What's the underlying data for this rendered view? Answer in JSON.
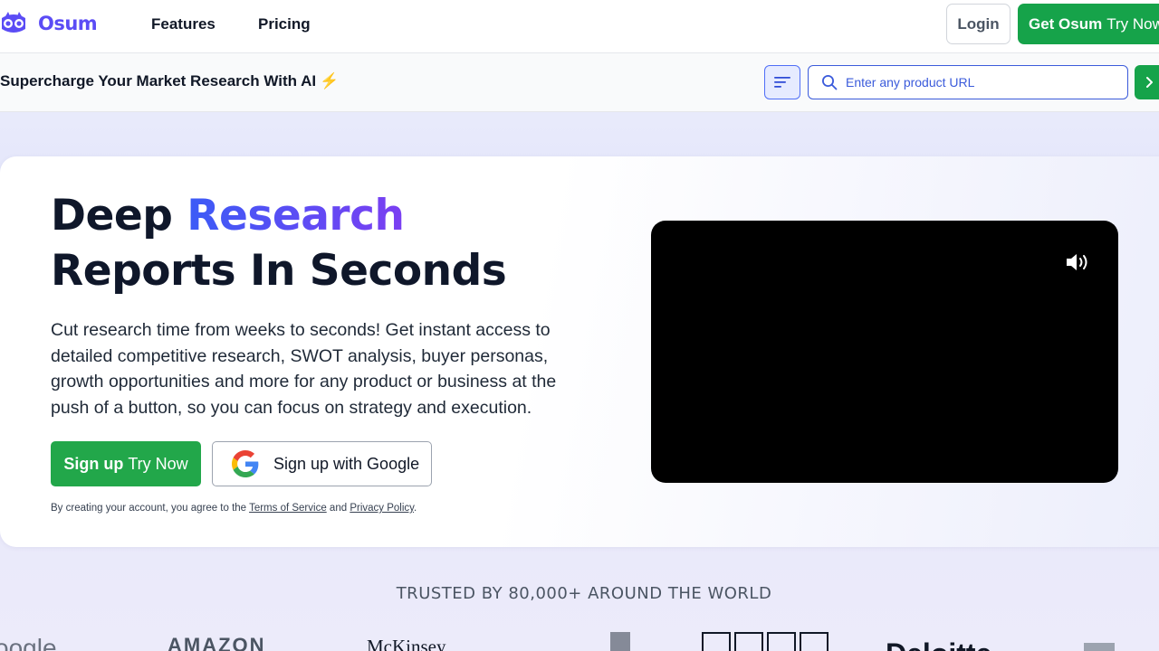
{
  "brand": {
    "name": "Osum",
    "color": "#5b4cf5"
  },
  "nav": {
    "features": "Features",
    "pricing": "Pricing",
    "login": "Login",
    "get_bold": "Get Osum",
    "get_rest": "Try Now"
  },
  "subbar": {
    "tagline": "Supercharge Your Market Research With AI",
    "bolt": "⚡",
    "search_placeholder": "Enter any product URL"
  },
  "hero": {
    "title_part1": "Deep",
    "title_accent": "Research",
    "title_line2": "Reports In Seconds",
    "description": "Cut research time from weeks to seconds! Get instant access to detailed competitive research, SWOT analysis, buyer personas, growth opportunities and more for any product or business at the push of a button, so you can focus on strategy and execution.",
    "signup_bold": "Sign up",
    "signup_rest": "Try Now",
    "google_label": "Sign up with Google",
    "legal_prefix": "By creating your account, you agree to the",
    "terms": "Terms of Service",
    "legal_and": "and",
    "privacy": "Privacy Policy",
    "legal_suffix": "."
  },
  "trusted": {
    "heading": "TRUSTED BY 80,000+ AROUND THE WORLD",
    "logos": [
      "oogle",
      "AMAZON",
      "McKinsey",
      "Deloitte"
    ]
  },
  "colors": {
    "green": "#16a34a",
    "accent_blue": "#3b5bdb",
    "accent_purple": "#7b3ff2"
  }
}
